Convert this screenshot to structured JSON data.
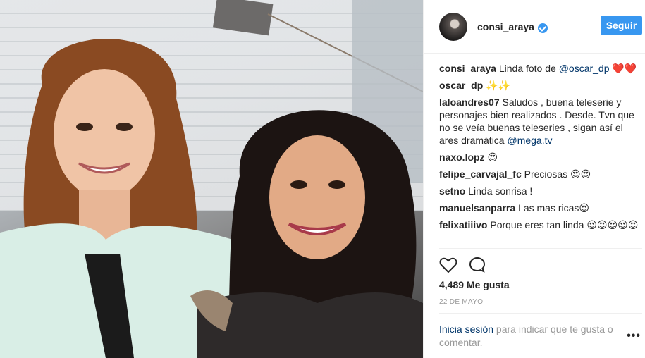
{
  "post": {
    "author": {
      "username": "consi_araya",
      "verified": true,
      "follow_label": "Seguir"
    },
    "comments": [
      {
        "user": "consi_araya",
        "text": "Linda foto de ",
        "mention": "@oscar_dp",
        "suffix": " ❤️❤️"
      },
      {
        "user": "oscar_dp",
        "text": "✨✨",
        "mention": "",
        "suffix": ""
      },
      {
        "user": "laloandres07",
        "text": "Saludos , buena teleserie y personajes bien realizados . Desde. Tvn que no se veía buenas teleseries , sigan así el ares dramática ",
        "mention": "@mega.tv",
        "suffix": ""
      },
      {
        "user": "naxo.lopz",
        "text": "😍",
        "mention": "",
        "suffix": ""
      },
      {
        "user": "felipe_carvajal_fc",
        "text": "Preciosas 😍😍",
        "mention": "",
        "suffix": ""
      },
      {
        "user": "setno",
        "text": "Linda sonrisa !",
        "mention": "",
        "suffix": ""
      },
      {
        "user": "manuelsanparra",
        "text": "Las mas ricas😍",
        "mention": "",
        "suffix": ""
      },
      {
        "user": "felixatiiivo",
        "text": "Porque eres tan linda 😍😍😍😍😍",
        "mention": "",
        "suffix": ""
      }
    ],
    "likes_label": "4,489 Me gusta",
    "date": "22 DE MAYO",
    "login_link": "Inicia sesión",
    "login_text": " para indicar que te gusta o comentar.",
    "more_label": "•••",
    "icons": {
      "like": "heart-icon",
      "comment": "comment-icon",
      "verified": "verified-badge-icon",
      "more": "more-options-icon"
    },
    "colors": {
      "accent": "#3897f0",
      "link": "#003569",
      "muted": "#999999"
    }
  }
}
